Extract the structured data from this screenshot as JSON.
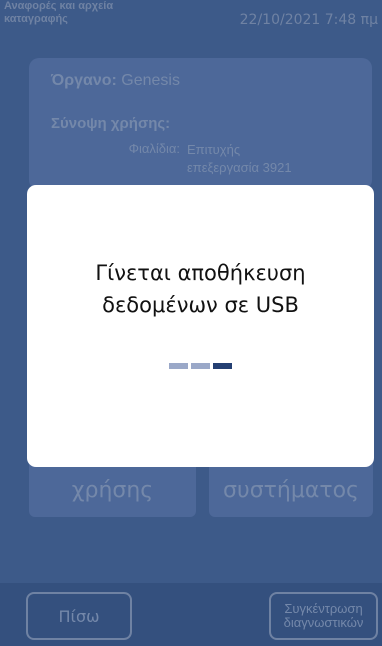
{
  "header": {
    "title": "Αναφορές και αρχεία καταγραφής",
    "datetime": "22/10/2021 7:48 πμ"
  },
  "info": {
    "instrument_label": "Όργανο:",
    "instrument_value": "Genesis",
    "summary_label": "Σύνοψη χρήσης:",
    "vial_label": "Φιαλίδια:",
    "vial_value_line1": "Επιτυχής",
    "vial_value_line2": "επεξεργασία 3921"
  },
  "buttons": {
    "left_label": "χρήσης",
    "right_label": "συστήματος",
    "back_label": "Πίσω",
    "diag_line1": "Συγκέντρωση",
    "diag_line2": "διαγνωστικών"
  },
  "modal": {
    "line1": "Γίνεται αποθήκευση",
    "line2": "δεδομένων σε USB",
    "progress_active_index": 2,
    "progress_count": 3
  },
  "colors": {
    "background": "#3d5a89",
    "modal": "#ffffff",
    "progress_active": "#243f72",
    "progress_inactive": "#9aa8c8"
  }
}
